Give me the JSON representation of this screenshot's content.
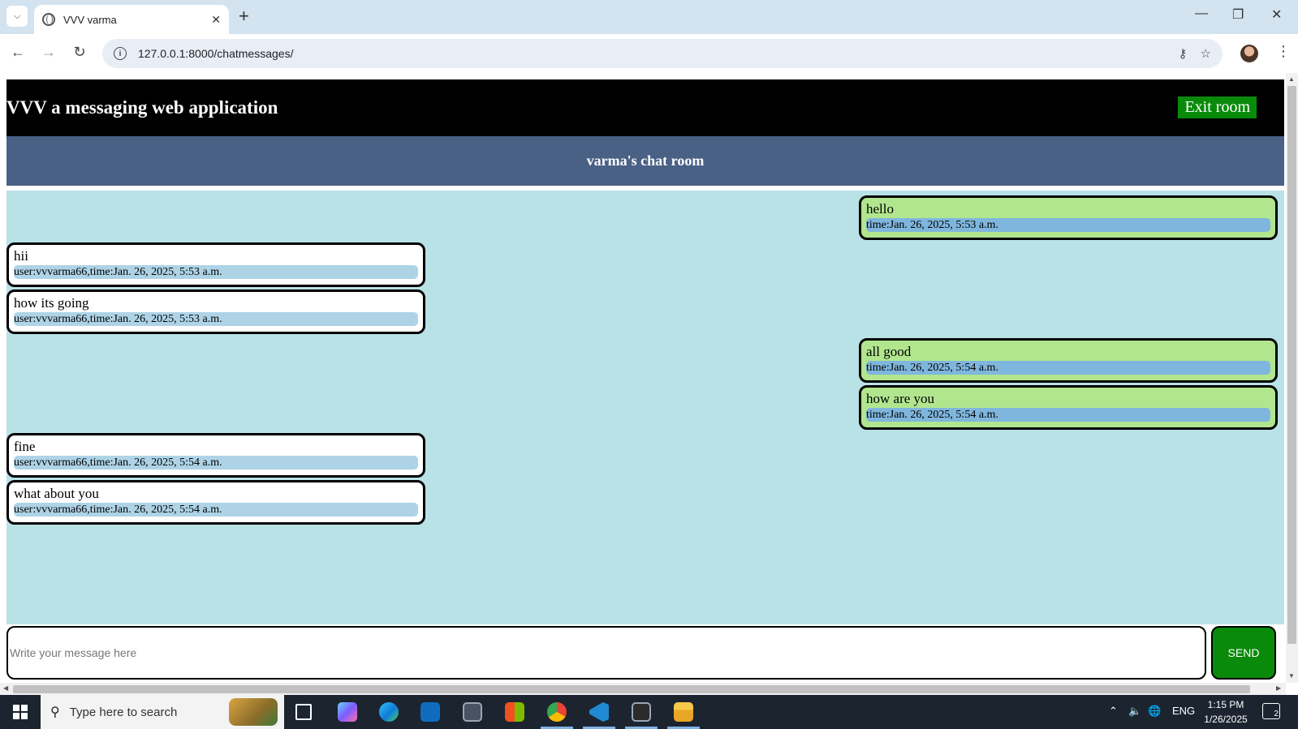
{
  "browser": {
    "tab_title": "VVV varma",
    "url": "127.0.0.1:8000/chatmessages/"
  },
  "page": {
    "app_title": "VVV a messaging web application",
    "exit_label": "Exit room",
    "room_title": "varma's chat room",
    "messages": [
      {
        "side": "mine",
        "text": "hello",
        "meta": "time:Jan. 26, 2025, 5:53 a.m."
      },
      {
        "side": "theirs",
        "text": "hii",
        "meta": "user:vvvarma66,time:Jan. 26, 2025, 5:53 a.m."
      },
      {
        "side": "theirs",
        "text": "how its going",
        "meta": "user:vvvarma66,time:Jan. 26, 2025, 5:53 a.m."
      },
      {
        "side": "mine",
        "text": "all good",
        "meta": "time:Jan. 26, 2025, 5:54 a.m."
      },
      {
        "side": "mine",
        "text": "how are you",
        "meta": "time:Jan. 26, 2025, 5:54 a.m."
      },
      {
        "side": "theirs",
        "text": "fine",
        "meta": "user:vvvarma66,time:Jan. 26, 2025, 5:54 a.m."
      },
      {
        "side": "theirs",
        "text": "what about you",
        "meta": "user:vvvarma66,time:Jan. 26, 2025, 5:54 a.m."
      }
    ],
    "input_placeholder": "Write your message here",
    "send_label": "SEND"
  },
  "taskbar": {
    "search_placeholder": "Type here to search",
    "language": "ENG",
    "time": "1:15 PM",
    "date": "1/26/2025",
    "notification_count": "2"
  },
  "colors": {
    "header_bg": "#000000",
    "room_bar": "#4a6186",
    "chat_bg": "#b9e2e7",
    "mine_bubble": "#b1e68f",
    "theirs_bubble": "#ffffff",
    "action_green": "#0a8a0a"
  }
}
